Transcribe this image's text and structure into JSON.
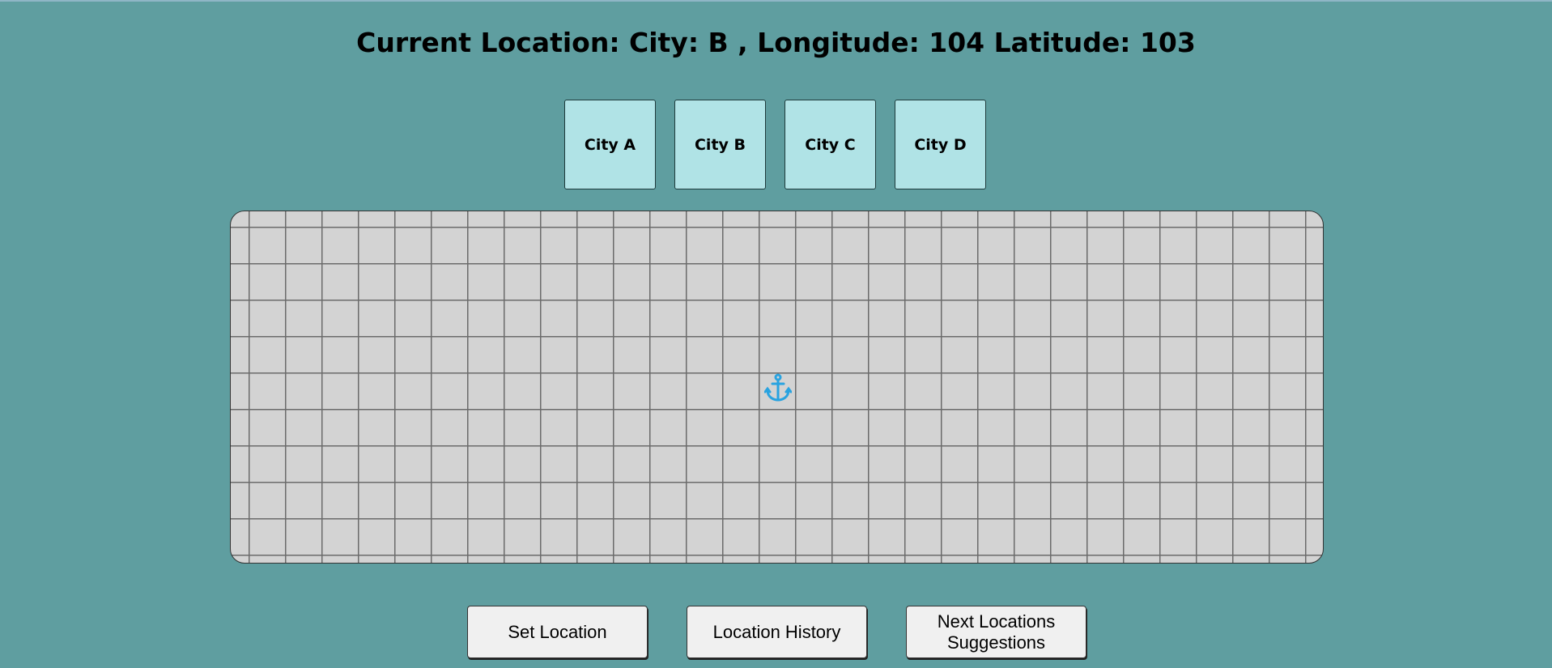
{
  "header": {
    "title": "Current Location: City: B , Longitude: 104 Latitude: 103"
  },
  "cities": [
    {
      "label": "City A"
    },
    {
      "label": "City B"
    },
    {
      "label": "City C"
    },
    {
      "label": "City D"
    }
  ],
  "map": {
    "marker_icon": "anchor-icon",
    "marker_color": "#29a3e0",
    "background_color": "#d3d3d3",
    "grid_color": "#6b6b6b"
  },
  "actions": {
    "set_location": "Set Location",
    "location_history": "Location History",
    "next_suggestions": "Next Locations Suggestions"
  },
  "colors": {
    "page_background": "#5f9ea0",
    "city_button_background": "#b0e3e6",
    "action_button_background": "#f0f0f0"
  }
}
